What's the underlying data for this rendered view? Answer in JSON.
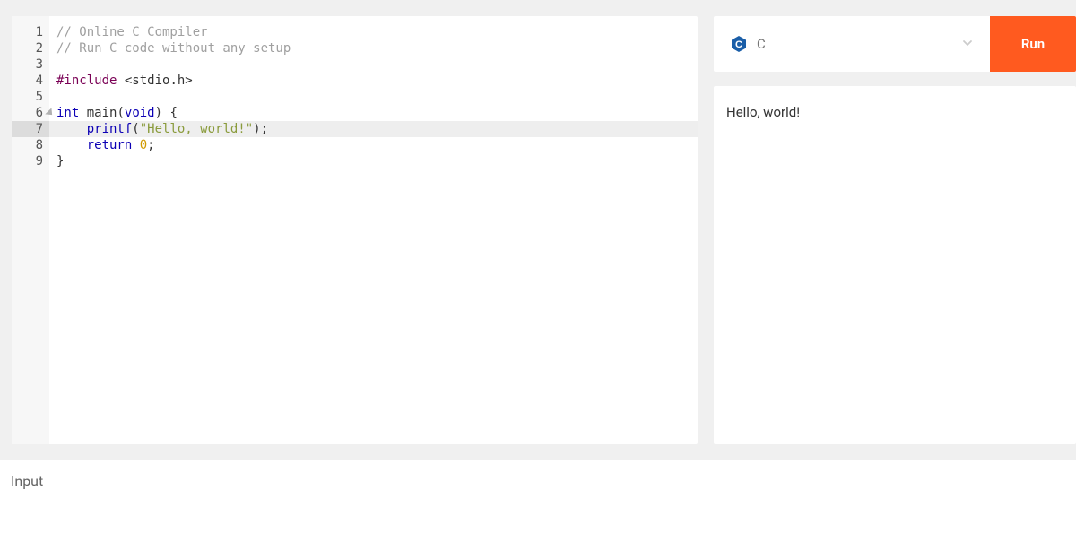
{
  "editor": {
    "line_numbers": [
      "1",
      "2",
      "3",
      "4",
      "5",
      "6",
      "7",
      "8",
      "9"
    ],
    "highlighted_line": 7,
    "fold_line": 6,
    "code": {
      "l1_comment": "// Online C Compiler",
      "l2_comment": "// Run C code without any setup",
      "l4_directive": "#include",
      "l4_path": " <stdio.h>",
      "l6_type": "int",
      "l6_name": " main",
      "l6_params_open": "(",
      "l6_void": "void",
      "l6_params_close": ") {",
      "l7_indent": "    ",
      "l7_func": "printf",
      "l7_open": "(",
      "l7_str": "\"Hello, world!\"",
      "l7_close": ");",
      "l8_indent": "    ",
      "l8_return": "return",
      "l8_space": " ",
      "l8_zero": "0",
      "l8_semi": ";",
      "l9_close": "}"
    }
  },
  "toolbar": {
    "language": "C",
    "run_label": "Run"
  },
  "output": {
    "text": "Hello, world!"
  },
  "input": {
    "label": "Input"
  }
}
